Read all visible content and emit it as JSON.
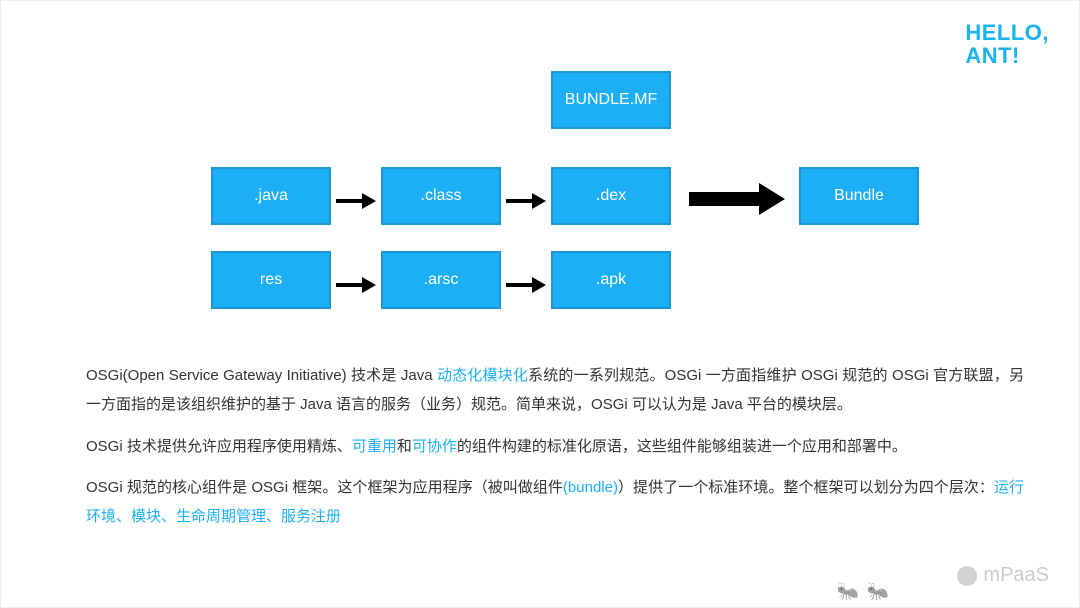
{
  "logo": {
    "line1": "HELLO,",
    "line2": "ANT!"
  },
  "diagram": {
    "boxes": {
      "bundlemf": "BUNDLE.MF",
      "java": ".java",
      "class": ".class",
      "dex": ".dex",
      "res": "res",
      "arsc": ".arsc",
      "apk": ".apk",
      "bundle": "Bundle"
    }
  },
  "paragraphs": {
    "p1_a": "OSGi(Open Service Gateway Initiative) 技术是 Java ",
    "p1_hl1": "动态化模块化",
    "p1_b": "系统的一系列规范。OSGi 一方面指维护 OSGi 规范的 OSGi 官方联盟，另一方面指的是该组织维护的基于 Java 语言的服务（业务）规范。简单来说，OSGi 可以认为是 Java 平台的模块层。",
    "p2_a": "OSGi 技术提供允许应用程序使用精炼、",
    "p2_hl1": "可重用",
    "p2_b": "和",
    "p2_hl2": "可协作",
    "p2_c": "的组件构建的标准化原语，这些组件能够组装进一个应用和部署中。",
    "p3_a": "OSGi 规范的核心组件是 OSGi 框架。这个框架为应用程序（被叫做组件",
    "p3_hl1": "(bundle)",
    "p3_b": "）提供了一个标准环境。整个框架可以划分为四个层次：",
    "p3_hl2": "运行环境、模块、生命周期管理、服务注册"
  },
  "watermark": {
    "text": "mPaaS"
  }
}
